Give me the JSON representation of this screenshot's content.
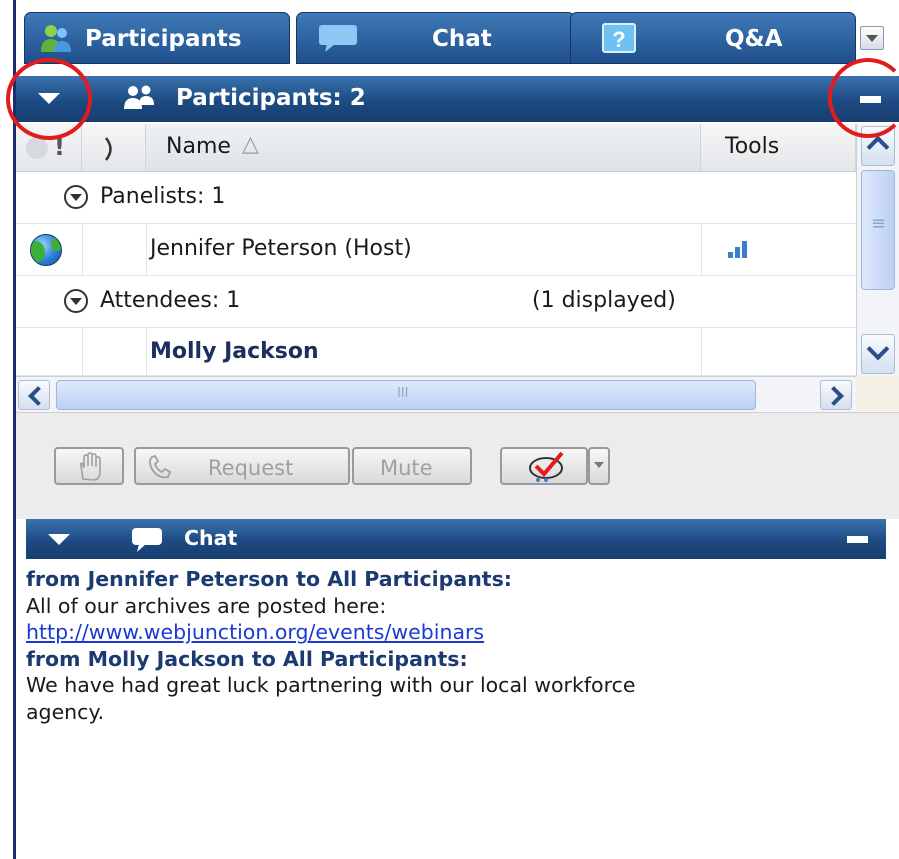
{
  "tabs": {
    "participants": "Participants",
    "chat": "Chat",
    "qa": "Q&A"
  },
  "participants_panel": {
    "title": "Participants: 2",
    "columns": {
      "name": "Name",
      "tools": "Tools"
    },
    "groups": {
      "panelists": "Panelists: 1",
      "attendees": "Attendees: 1",
      "attendees_displayed": "(1 displayed)"
    },
    "people": {
      "host": "Jennifer Peterson (Host)",
      "attendee": "Molly Jackson"
    },
    "header_symbols": {
      "status": "!",
      "sort": "△"
    }
  },
  "toolbar": {
    "request": "Request",
    "mute": "Mute"
  },
  "chat_panel": {
    "title": "Chat",
    "messages": [
      {
        "from": "from Jennifer Peterson to All Participants:",
        "text": "All of our archives are posted here:",
        "link": "http://www.webjunction.org/events/webinars"
      },
      {
        "from": "from Molly Jackson to All Participants:",
        "text_line1": "We have had great luck partnering with our local workforce",
        "text_line2": "agency."
      }
    ]
  },
  "colors": {
    "header_blue": "#1d4a82",
    "highlight_ring": "#e21c1c",
    "chat_sender": "#1c3a72",
    "link": "#1a3ad6"
  },
  "icons": [
    "participants-icon",
    "chat-bubble-icon",
    "help-icon",
    "people-icon",
    "globe-icon",
    "signal-bars-icon",
    "raise-hand-icon",
    "phone-icon",
    "poll-check-icon"
  ]
}
